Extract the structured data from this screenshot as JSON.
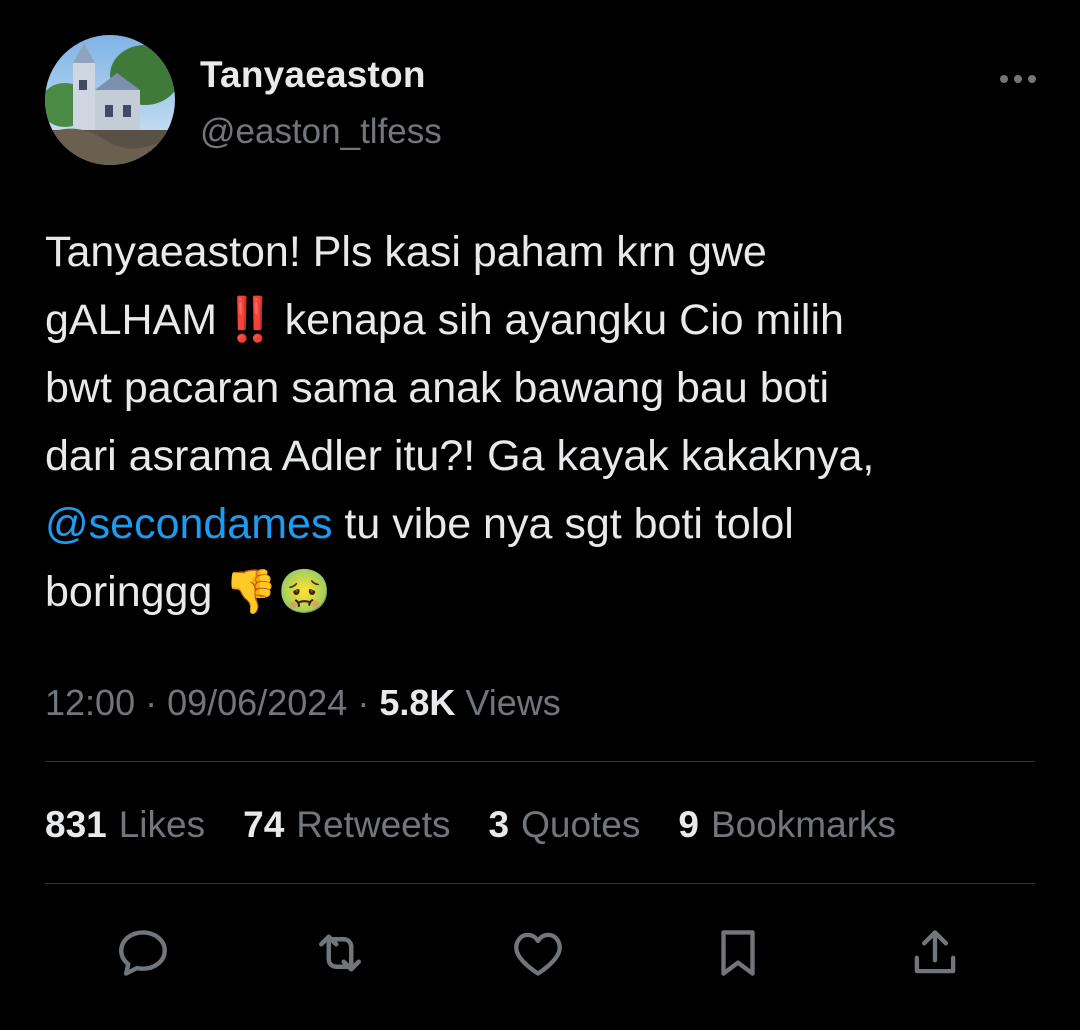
{
  "author": {
    "display_name": "Tanyaeaston",
    "handle": "@easton_tlfess"
  },
  "tweet": {
    "lines": [
      {
        "text": "Tanyaeaston! Pls kasi paham krn gwe"
      },
      {
        "before": "gALHAM",
        "emoji": "‼️",
        "after": "kenapa sih ayangku Cio milih"
      },
      {
        "text": "bwt pacaran sama anak bawang bau boti"
      },
      {
        "text": "dari asrama Adler itu?! Ga kayak kakaknya,"
      },
      {
        "mention": "@secondames",
        "after": " tu vibe nya sgt boti tolol"
      },
      {
        "text": "boringgg",
        "emojis": "👎🤢"
      }
    ]
  },
  "meta": {
    "time": "12:00",
    "date": "09/06/2024",
    "views_count": "5.8K",
    "views_label": "Views"
  },
  "stats": {
    "likes_count": "831",
    "likes_label": "Likes",
    "retweets_count": "74",
    "retweets_label": "Retweets",
    "quotes_count": "3",
    "quotes_label": "Quotes",
    "bookmarks_count": "9",
    "bookmarks_label": "Bookmarks"
  },
  "actions": [
    "reply-icon",
    "retweet-icon",
    "like-icon",
    "bookmark-icon",
    "share-icon"
  ],
  "colors": {
    "background": "#000000",
    "text": "#e7e9ea",
    "secondary": "#71767b",
    "link": "#1d9bf0",
    "divider": "#2f3336"
  }
}
